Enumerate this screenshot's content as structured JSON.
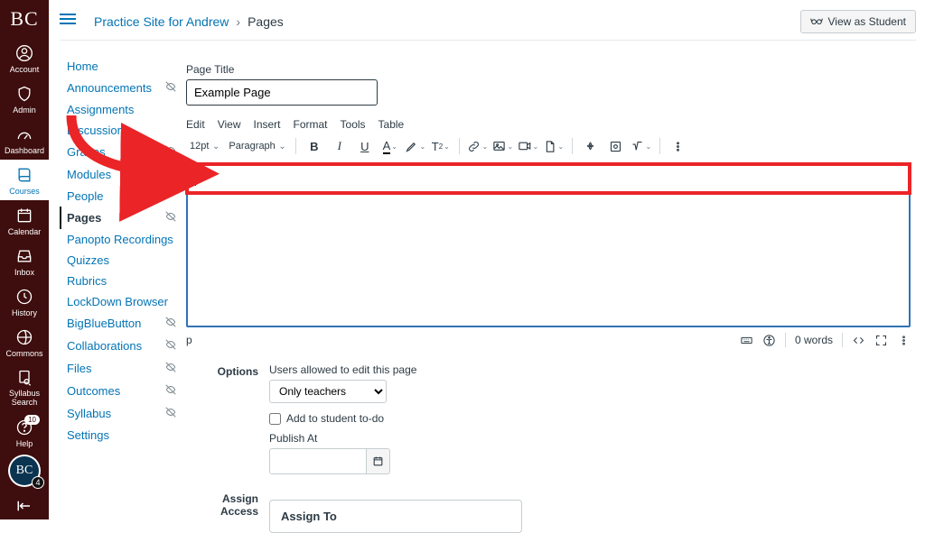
{
  "gnav": {
    "logo": "BC",
    "items": [
      {
        "label": "Account",
        "icon": "user-circle"
      },
      {
        "label": "Admin",
        "icon": "speed"
      },
      {
        "label": "Dashboard",
        "icon": "gauge"
      },
      {
        "label": "Courses",
        "icon": "book",
        "active": true
      },
      {
        "label": "Calendar",
        "icon": "calendar"
      },
      {
        "label": "Inbox",
        "icon": "inbox"
      },
      {
        "label": "History",
        "icon": "clock"
      },
      {
        "label": "Commons",
        "icon": "share"
      },
      {
        "label": "Syllabus Search",
        "icon": "search-doc"
      },
      {
        "label": "Help",
        "icon": "help",
        "badge": "10"
      }
    ],
    "avatar_text": "BC",
    "avatar_badge": "4"
  },
  "header": {
    "breadcrumb_site": "Practice Site for Andrew",
    "breadcrumb_page": "Pages",
    "view_as_student": "View as Student"
  },
  "cnav": {
    "items": [
      {
        "label": "Home"
      },
      {
        "label": "Announcements",
        "hidden": true
      },
      {
        "label": "Assignments"
      },
      {
        "label": "Discussions"
      },
      {
        "label": "Grades",
        "hidden": true
      },
      {
        "label": "Modules",
        "hidden": true
      },
      {
        "label": "People"
      },
      {
        "label": "Pages",
        "hidden": true,
        "active": true
      },
      {
        "label": "Panopto Recordings"
      },
      {
        "label": "Quizzes"
      },
      {
        "label": "Rubrics"
      },
      {
        "label": "LockDown Browser"
      },
      {
        "label": "BigBlueButton",
        "hidden": true
      },
      {
        "label": "Collaborations",
        "hidden": true
      },
      {
        "label": "Files",
        "hidden": true
      },
      {
        "label": "Outcomes",
        "hidden": true
      },
      {
        "label": "Syllabus",
        "hidden": true
      },
      {
        "label": "Settings"
      }
    ]
  },
  "page": {
    "title_label": "Page Title",
    "title_value": "Example Page",
    "menus": [
      "Edit",
      "View",
      "Insert",
      "Format",
      "Tools",
      "Table"
    ],
    "font_size": "12pt",
    "block_format": "Paragraph",
    "path_indicator": "p",
    "word_count": "0 words",
    "options_label": "Options",
    "users_edit_label": "Users allowed to edit this page",
    "role_select": "Only teachers",
    "todo_label": "Add to student to-do",
    "publish_label": "Publish At",
    "assign_access_label": "Assign Access",
    "assign_to_label": "Assign To"
  }
}
